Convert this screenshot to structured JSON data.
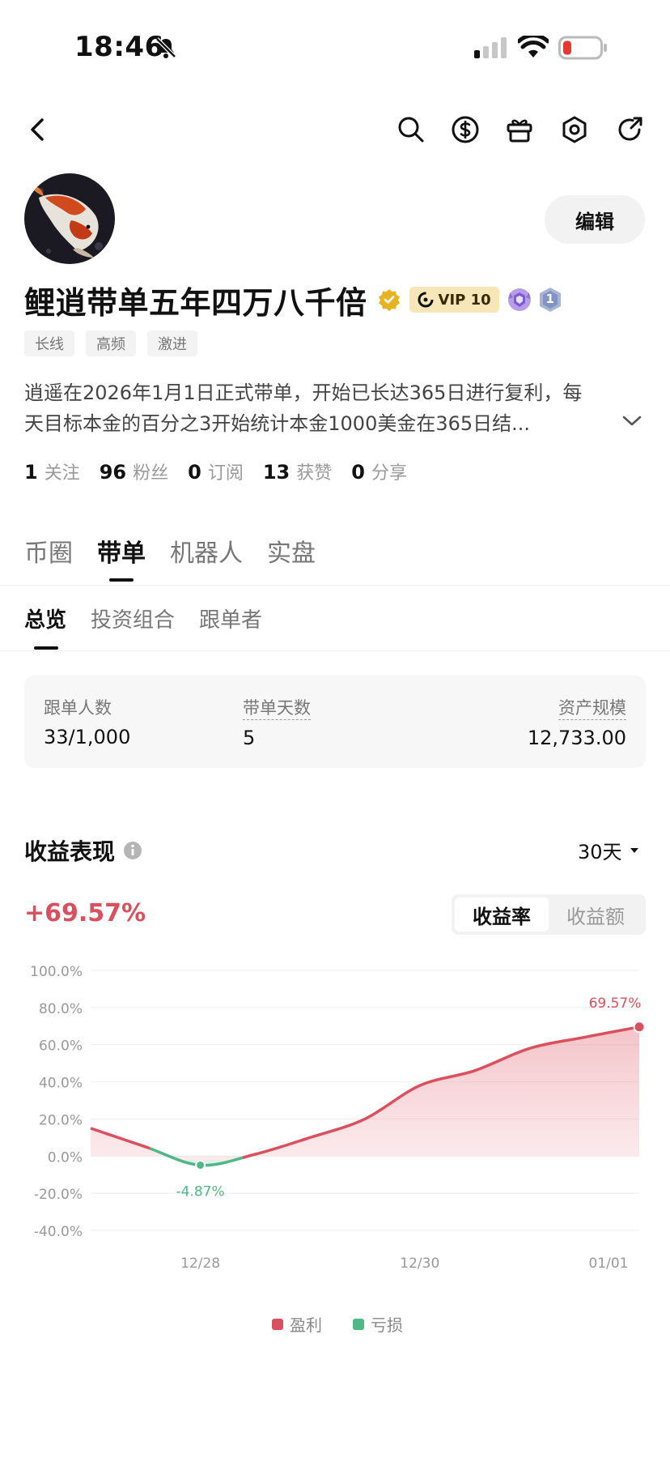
{
  "status_bar": {
    "time": "18:46"
  },
  "profile": {
    "name": "鲤逍带单五年四万八千倍",
    "vip_label": "VIP 10",
    "level_badge": "1",
    "edit_label": "编辑",
    "tags": [
      "长线",
      "高频",
      "激进"
    ],
    "bio_line1": "逍遥在2026年1月1日正式带单，开始已长达365日进行复利，每",
    "bio_line2": "天目标本金的百分之3开始统计本金1000美金在365日结...",
    "stats": [
      {
        "num": "1",
        "label": "关注"
      },
      {
        "num": "96",
        "label": "粉丝"
      },
      {
        "num": "0",
        "label": "订阅"
      },
      {
        "num": "13",
        "label": "获赞"
      },
      {
        "num": "0",
        "label": "分享"
      }
    ]
  },
  "main_tabs": [
    "币圈",
    "带单",
    "机器人",
    "实盘"
  ],
  "sub_tabs": [
    "总览",
    "投资组合",
    "跟单者"
  ],
  "summary": {
    "followers_label": "跟单人数",
    "followers_value": "33/1,000",
    "days_label": "带单天数",
    "days_value": "5",
    "aum_label": "资产规模",
    "aum_value": "12,733.00"
  },
  "performance": {
    "title": "收益表现",
    "period": "30天",
    "value": "+69.57%",
    "toggle": [
      "收益率",
      "收益额"
    ]
  },
  "chart_data": {
    "type": "area",
    "y_ticks": [
      "100.0%",
      "80.0%",
      "60.0%",
      "40.0%",
      "20.0%",
      "0.0%",
      "-20.0%",
      "-40.0%"
    ],
    "ylim": [
      -40,
      100
    ],
    "x_ticks": [
      "12/28",
      "12/30",
      "01/01"
    ],
    "x": [
      0,
      0.1,
      0.2,
      0.3,
      0.4,
      0.5,
      0.6,
      0.7,
      0.8,
      0.9,
      1.0
    ],
    "values": [
      15,
      5,
      -4.87,
      1,
      10,
      20,
      38,
      46,
      58,
      64,
      69.57
    ],
    "min_label": "-4.87%",
    "max_label": "69.57%",
    "series": [
      {
        "name": "盈利",
        "color": "#d9505e"
      },
      {
        "name": "亏损",
        "color": "#4fb886"
      }
    ]
  },
  "colors": {
    "profit": "#d9505e",
    "loss": "#4fb886",
    "vip_bg": "#f7e7b8"
  }
}
